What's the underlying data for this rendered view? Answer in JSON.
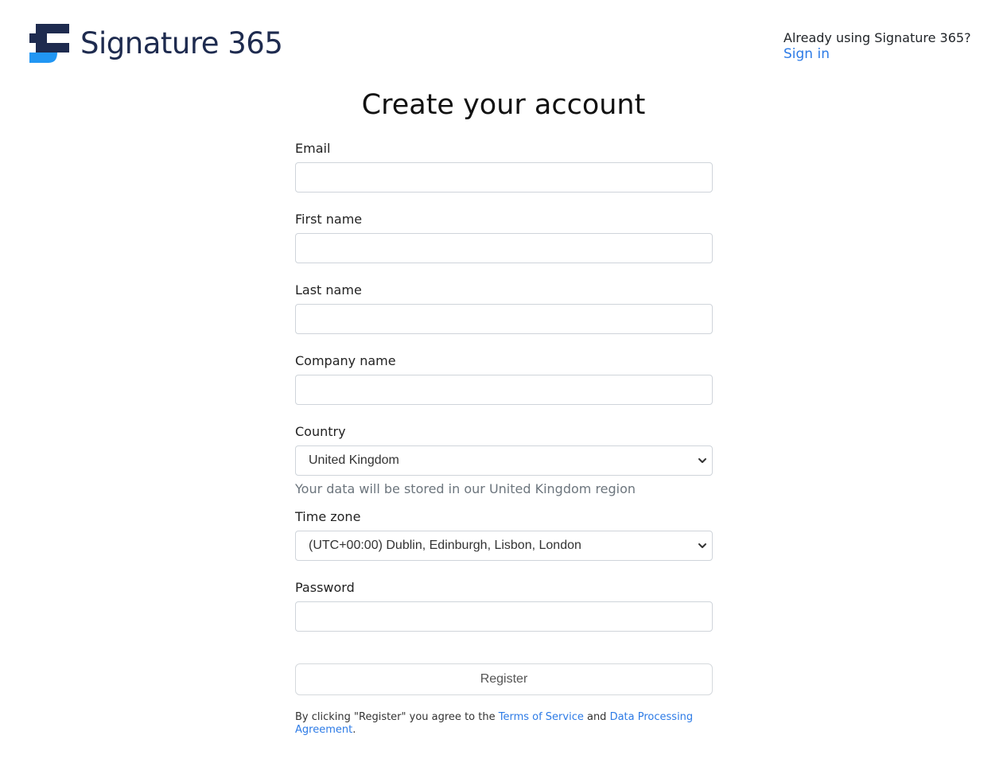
{
  "brand": {
    "name": "Signature 365",
    "logo_dark": "#1e2b4f",
    "logo_accent": "#2196f3"
  },
  "header": {
    "already_text": "Already using Signature 365?",
    "sign_in_link": "Sign in",
    "link_color": "#2d7be6"
  },
  "title": "Create your account",
  "form": {
    "email_label": "Email",
    "email_value": "",
    "first_name_label": "First name",
    "first_name_value": "",
    "last_name_label": "Last name",
    "last_name_value": "",
    "company_label": "Company name",
    "company_value": "",
    "country_label": "Country",
    "country_selected": "United Kingdom",
    "country_helper": "Your data will be stored in our United Kingdom region",
    "timezone_label": "Time zone",
    "timezone_selected": "(UTC+00:00) Dublin, Edinburgh, Lisbon, London",
    "password_label": "Password",
    "password_value": "",
    "register_label": "Register"
  },
  "terms": {
    "prefix": "By clicking \"Register\" you agree to the ",
    "tos_link": "Terms of Service",
    "and": " and ",
    "dpa_link": "Data Processing Agreement",
    "suffix": "."
  }
}
